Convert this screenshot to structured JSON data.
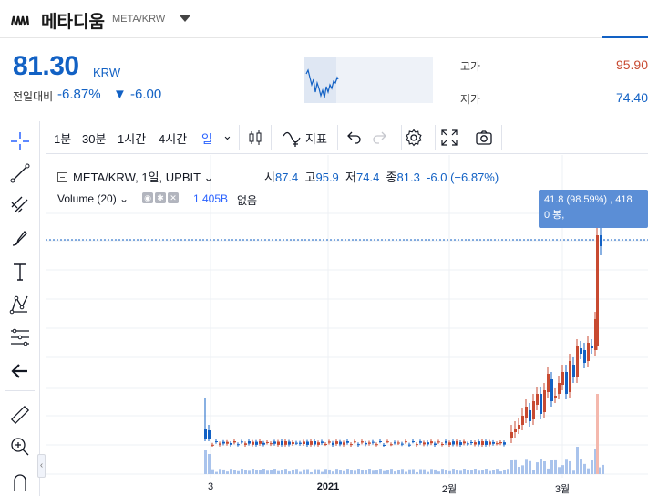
{
  "header": {
    "coin_name": "메타디움",
    "market": "META/KRW",
    "price": "81.30",
    "price_unit": "KRW",
    "change_label": "전일대비",
    "change_percent": "-6.87%",
    "change_value": "▼ -6.00",
    "high_label": "고가",
    "high_value": "95.90",
    "low_label": "저가",
    "low_value": "74.40"
  },
  "toolbar": {
    "intervals": [
      "1분",
      "30분",
      "1시간",
      "4시간",
      "일"
    ],
    "active_interval": "일",
    "indicator_label": "지표"
  },
  "legend": {
    "symbol": "META/KRW, 1일, UPBIT",
    "open_label": "시",
    "open": "87.4",
    "high_label": "고",
    "high": "95.9",
    "low_label": "저",
    "low": "74.4",
    "close_label": "종",
    "close": "81.3",
    "change": "-6.0 (−6.87%)",
    "volume_label": "Volume (20)",
    "volume_value": "1.405B",
    "volume_none": "없음"
  },
  "tooltip": {
    "line1": "41.8 (98.59%) , 418",
    "line2": "0 봉,"
  },
  "x_axis_labels": [
    "3",
    "2021",
    "2월",
    "3월"
  ],
  "icons": {
    "left_tools": [
      "crosshair-icon",
      "trend-line-icon",
      "fib-icon",
      "brush-icon",
      "text-icon",
      "pattern-icon",
      "measure-lines-icon",
      "back-arrow-icon",
      "ruler-icon",
      "zoom-in-icon",
      "magnet-icon"
    ],
    "toolbar": [
      "candle-type-icon",
      "indicator-icon",
      "undo-icon",
      "redo-icon",
      "settings-icon",
      "fullscreen-icon",
      "camera-icon"
    ]
  },
  "colors": {
    "up": "#c84a31",
    "down": "#1261c4",
    "accent": "#2962ff"
  }
}
